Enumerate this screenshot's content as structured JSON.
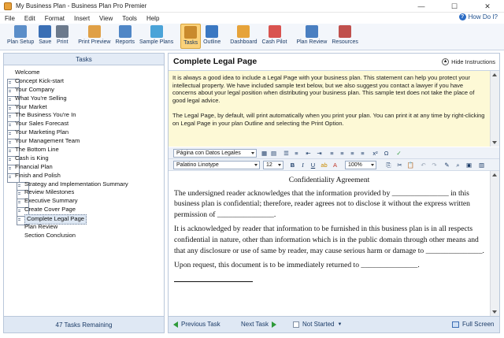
{
  "window": {
    "title": "My Business Plan - Business Plan Pro Premier",
    "minimize": "—",
    "maximize": "☐",
    "close": "✕"
  },
  "menu": [
    "File",
    "Edit",
    "Format",
    "Insert",
    "View",
    "Tools",
    "Help"
  ],
  "help_link": {
    "label": "How Do I?"
  },
  "toolbar": [
    {
      "label": "Plan Setup",
      "icon": "plan-setup-icon",
      "color": "#5b8ec9"
    },
    {
      "label": "Save",
      "icon": "save-icon",
      "color": "#3a6fb5"
    },
    {
      "label": "Print",
      "icon": "print-icon",
      "color": "#6c7a8c"
    },
    {
      "label": "Print Preview",
      "icon": "print-preview-icon",
      "color": "#e0a046"
    },
    {
      "label": "Reports",
      "icon": "reports-icon",
      "color": "#4f86c6"
    },
    {
      "label": "Sample Plans",
      "icon": "sample-plans-icon",
      "color": "#4aa3d8"
    },
    {
      "label": "Tasks",
      "icon": "tasks-icon",
      "color": "#c98a2c",
      "active": true
    },
    {
      "label": "Outline",
      "icon": "outline-icon",
      "color": "#3b78c2"
    },
    {
      "label": "Dashboard",
      "icon": "dashboard-icon",
      "color": "#e6a33a"
    },
    {
      "label": "Cash Pilot",
      "icon": "cash-pilot-icon",
      "color": "#d9534f"
    },
    {
      "label": "Plan Review",
      "icon": "plan-review-icon",
      "color": "#4a7fc1"
    },
    {
      "label": "Resources",
      "icon": "resources-icon",
      "color": "#c0504d"
    }
  ],
  "tasks": {
    "header": "Tasks",
    "items": [
      {
        "label": "Welcome",
        "level": 0,
        "doc": false
      },
      {
        "label": "Concept Kick-start",
        "level": 0,
        "doc": true
      },
      {
        "label": "Your Company",
        "level": 0,
        "doc": true
      },
      {
        "label": "What You're Selling",
        "level": 0,
        "doc": true
      },
      {
        "label": "Your Market",
        "level": 0,
        "doc": true
      },
      {
        "label": "The Business You're In",
        "level": 0,
        "doc": true
      },
      {
        "label": "Your Sales Forecast",
        "level": 0,
        "doc": true
      },
      {
        "label": "Your Marketing Plan",
        "level": 0,
        "doc": true
      },
      {
        "label": "Your Management Team",
        "level": 0,
        "doc": true
      },
      {
        "label": "The Bottom Line",
        "level": 0,
        "doc": true
      },
      {
        "label": "Cash is King",
        "level": 0,
        "doc": true
      },
      {
        "label": "Financial Plan",
        "level": 0,
        "doc": true
      },
      {
        "label": "Finish and Polish",
        "level": 0,
        "doc": true
      },
      {
        "label": "Strategy and Implementation Summary",
        "level": 1,
        "doc": true
      },
      {
        "label": "Review Milestones",
        "level": 1,
        "doc": true
      },
      {
        "label": "Executive Summary",
        "level": 1,
        "doc": true
      },
      {
        "label": "Create Cover Page",
        "level": 1,
        "doc": true
      },
      {
        "label": "Complete Legal Page",
        "level": 1,
        "doc": true,
        "selected": true
      },
      {
        "label": "Plan Review",
        "level": 1,
        "doc": false
      },
      {
        "label": "Section Conclusion",
        "level": 1,
        "doc": false
      }
    ],
    "remaining": "47 Tasks Remaining"
  },
  "page": {
    "title": "Complete Legal Page",
    "hide_instructions": "Hide Instructions",
    "instructions": [
      "It is always a good idea to include a Legal Page with your business plan. This statement can help you protect your intellectual property. We have included sample text below, but we also suggest you contact a lawyer if you have concerns about your legal position when distributing your business plan. This sample text does not take the place of good legal advice.",
      "The Legal Page, by default, will print automatically when you print your plan. You can print it at any time by right-clicking on Legal Page in your plan Outline and selecting the Print Option."
    ]
  },
  "format_bar": {
    "style": "Página con Datos Legales",
    "font": "Palatino Linotype",
    "size": "12",
    "zoom": "100%"
  },
  "document": {
    "heading": "Confidentiality Agreement",
    "paragraphs": [
      "The undersigned reader acknowledges that the information provided by _______________ in this business plan is confidential; therefore, reader agrees not to disclose it without the express written permission of _______________.",
      "It is acknowledged by reader that information to be furnished in this business plan is in all respects confidential in nature, other than information which is in the public domain through other means and that any disclosure or use of same by reader, may cause serious harm or damage to _______________.",
      "Upon request, this document is to be immediately returned to _______________."
    ]
  },
  "bottom_nav": {
    "previous": "Previous Task",
    "next": "Next Task",
    "status": "Not Started",
    "fullscreen": "Full Screen"
  }
}
